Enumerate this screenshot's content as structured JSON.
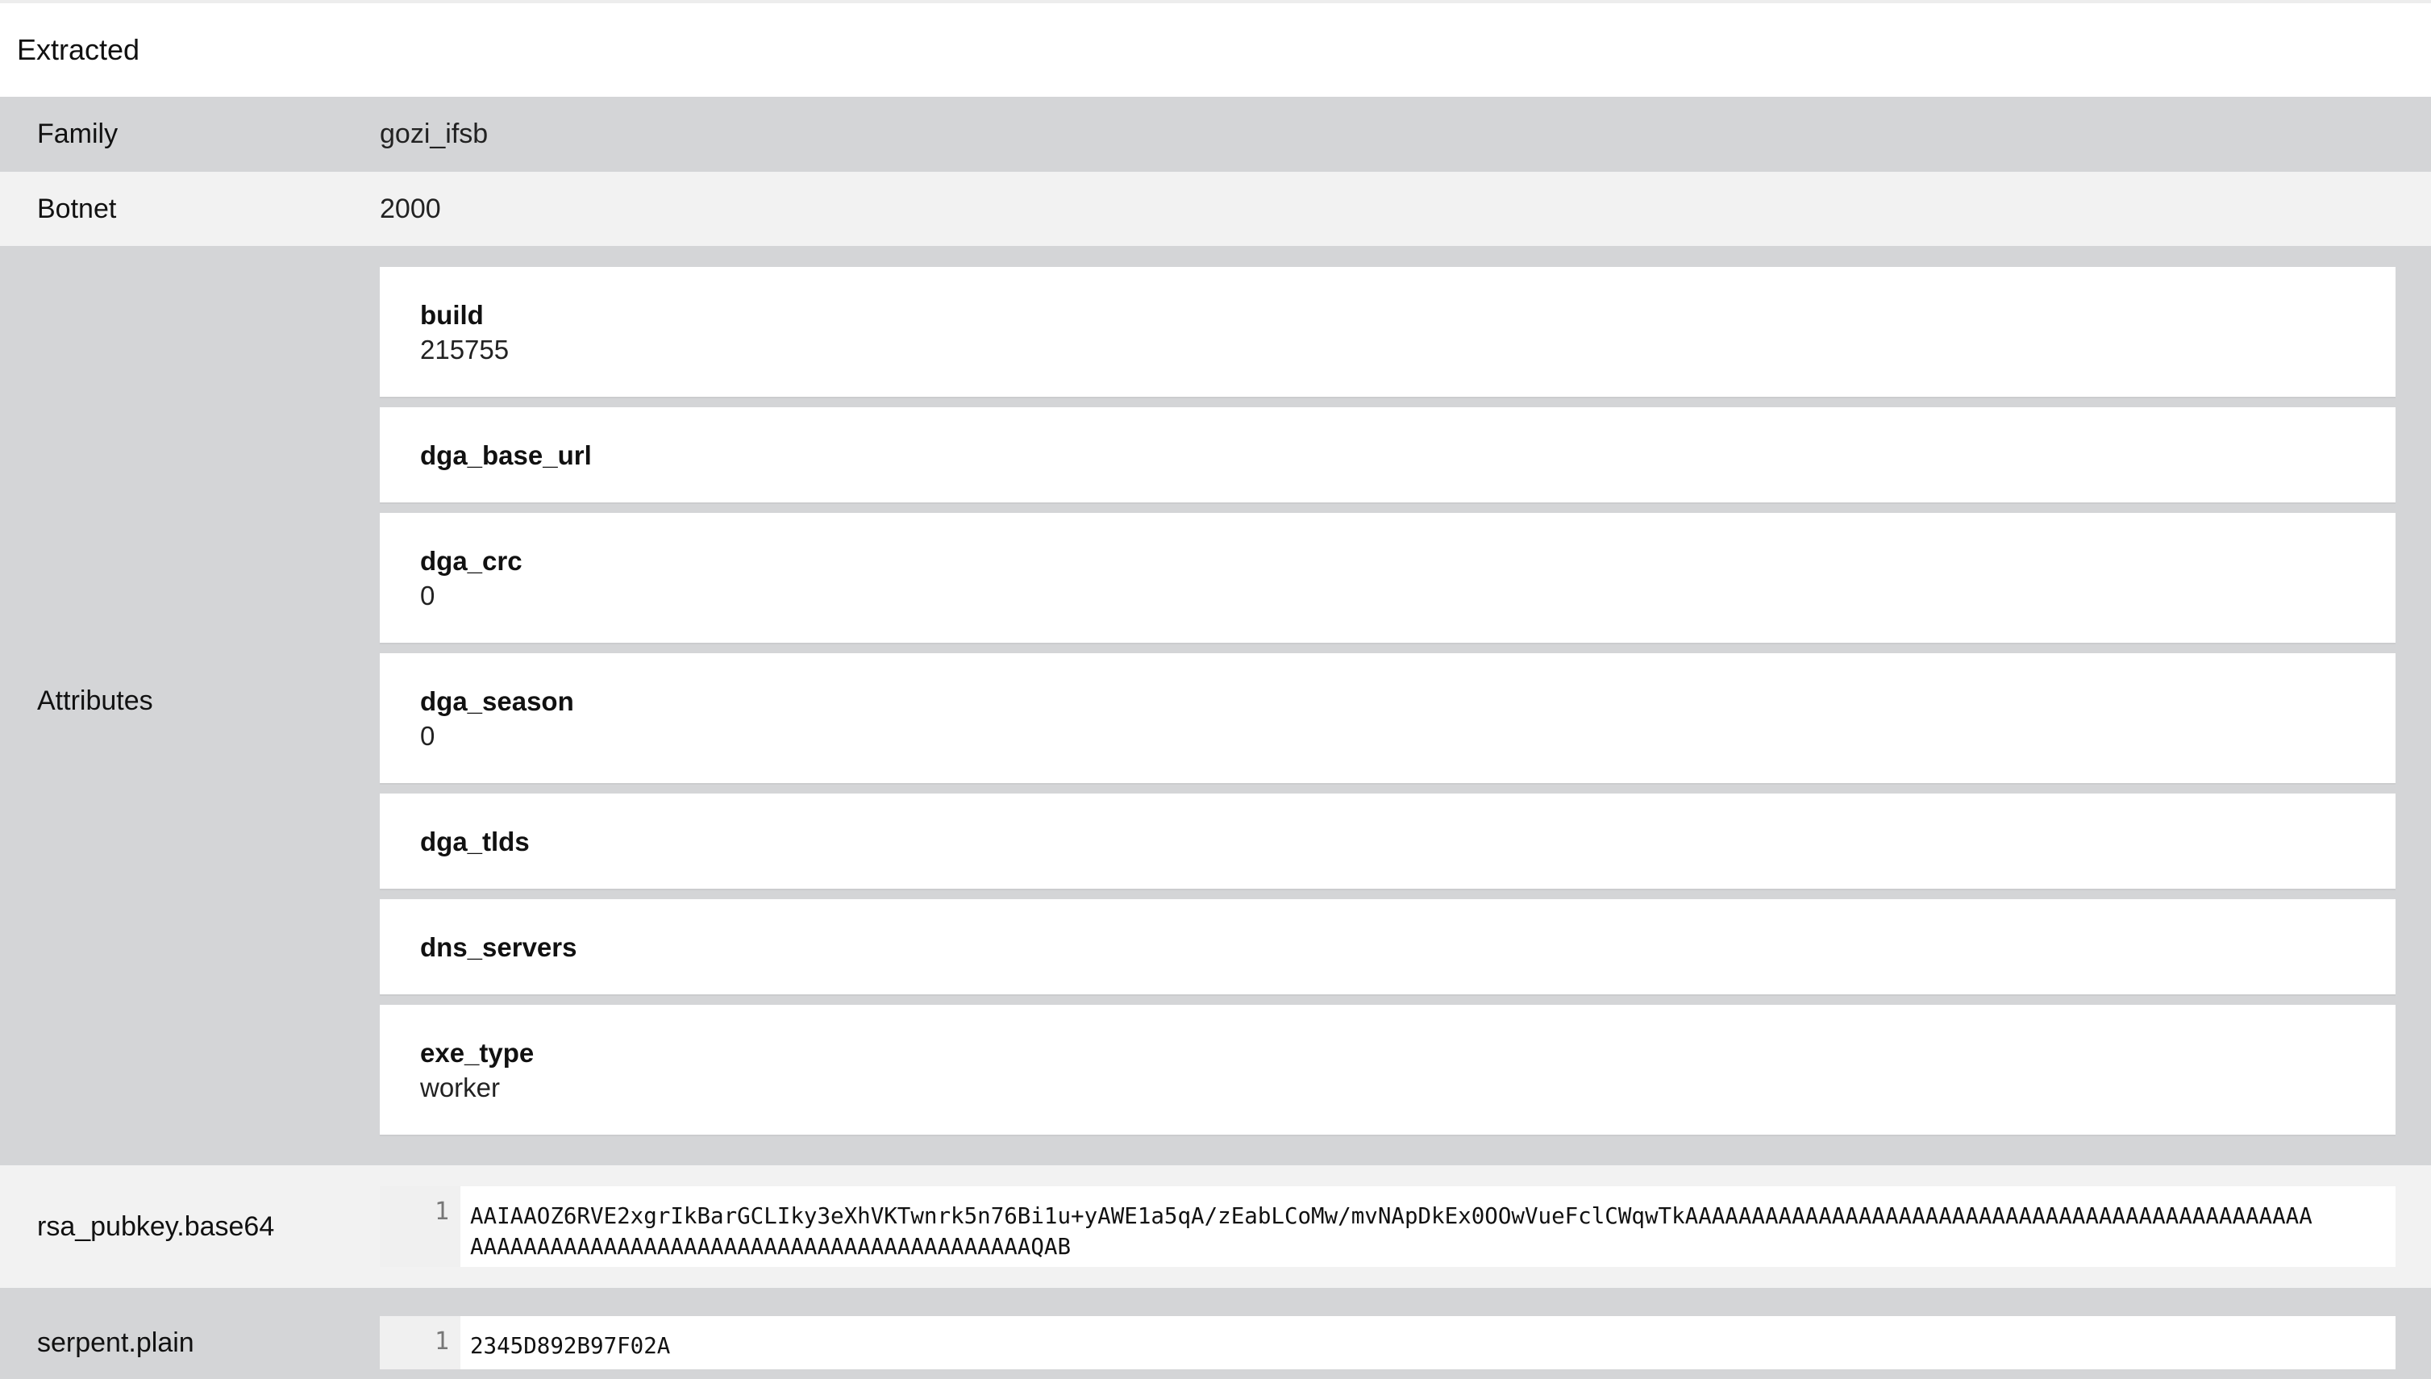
{
  "header": {
    "title": "Extracted"
  },
  "family": {
    "label": "Family",
    "value": "gozi_ifsb"
  },
  "botnet": {
    "label": "Botnet",
    "value": "2000"
  },
  "attributes": {
    "label": "Attributes",
    "items": [
      {
        "key": "build",
        "value": "215755"
      },
      {
        "key": "dga_base_url",
        "value": ""
      },
      {
        "key": "dga_crc",
        "value": "0"
      },
      {
        "key": "dga_season",
        "value": "0"
      },
      {
        "key": "dga_tlds",
        "value": ""
      },
      {
        "key": "dns_servers",
        "value": ""
      },
      {
        "key": "exe_type",
        "value": "worker"
      }
    ]
  },
  "rsa_pubkey": {
    "label": "rsa_pubkey.base64",
    "line_number": "1",
    "line1": "AAIAAOZ6RVE2xgrIkBarGCLIky3eXhVKTwnrk5n76Bi1u+yAWE1a5qA/zEabLCoMw/mvNApDkEx0OOwVueFclCWqwTkAAAAAAAAAAAAAAAAAAAAAAAAAAAAAAAAAAAAAAAAAAAAAAA",
    "line2": "AAAAAAAAAAAAAAAAAAAAAAAAAAAAAAAAAAAAAAAAAAQAB"
  },
  "serpent": {
    "label": "serpent.plain",
    "line_number": "1",
    "value": "2345D892B97F02A"
  }
}
